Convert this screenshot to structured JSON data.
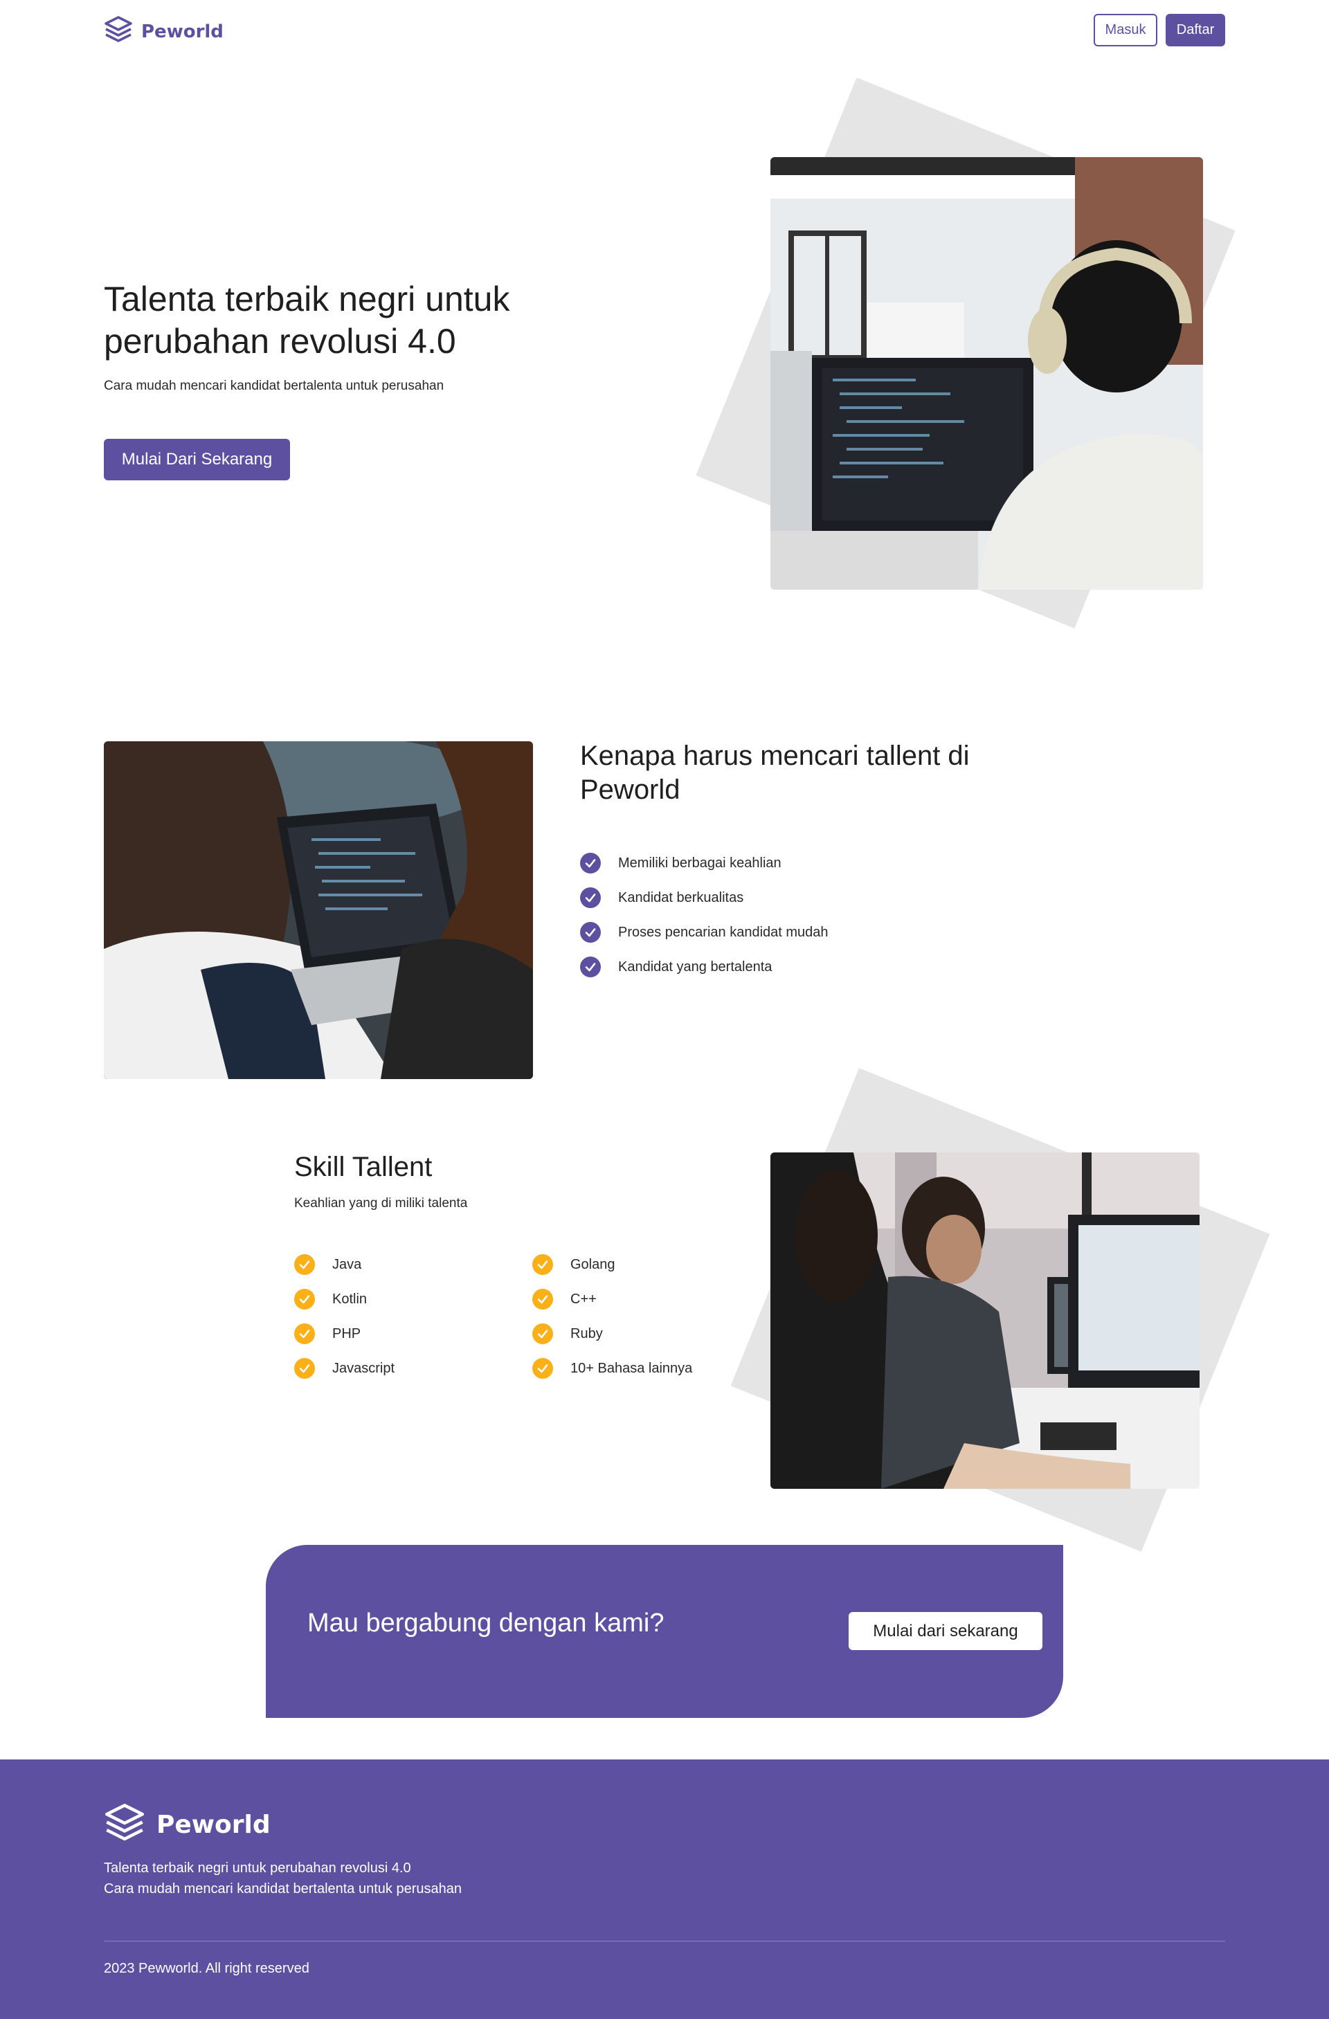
{
  "nav": {
    "brand": "Peworld",
    "login_label": "Masuk",
    "register_label": "Daftar"
  },
  "hero": {
    "title": "Talenta terbaik negri untuk perubahan revolusi 4.0",
    "subtitle": "Cara mudah mencari kandidat bertalenta untuk perusahan",
    "cta_label": "Mulai Dari Sekarang"
  },
  "why": {
    "title": "Kenapa harus mencari tallent di Peworld",
    "items": [
      {
        "label": "Memiliki berbagai keahlian",
        "icon": "check-icon"
      },
      {
        "label": "Kandidat berkualitas",
        "icon": "check-icon"
      },
      {
        "label": "Proses pencarian kandidat mudah",
        "icon": "check-icon"
      },
      {
        "label": "Kandidat yang bertalenta",
        "icon": "check-icon"
      }
    ]
  },
  "skills": {
    "title": "Skill Tallent",
    "subtitle": "Keahlian yang di miliki talenta",
    "left": [
      "Java",
      "Kotlin",
      "PHP",
      "Javascript"
    ],
    "right": [
      "Golang",
      "C++",
      "Ruby",
      "10+ Bahasa lainnya"
    ]
  },
  "cta": {
    "title": "Mau bergabung dengan kami?",
    "button_label": "Mulai dari sekarang"
  },
  "footer": {
    "brand": "Peworld",
    "tagline_1": "Talenta terbaik negri untuk perubahan revolusi 4.0",
    "tagline_2": "Cara mudah mencari kandidat bertalenta untuk perusahan",
    "copyright": "2023 Pewworld. All right reserved"
  },
  "colors": {
    "primary": "#5e50a1",
    "accent": "#fbb017",
    "shape": "#e5e5e5"
  }
}
